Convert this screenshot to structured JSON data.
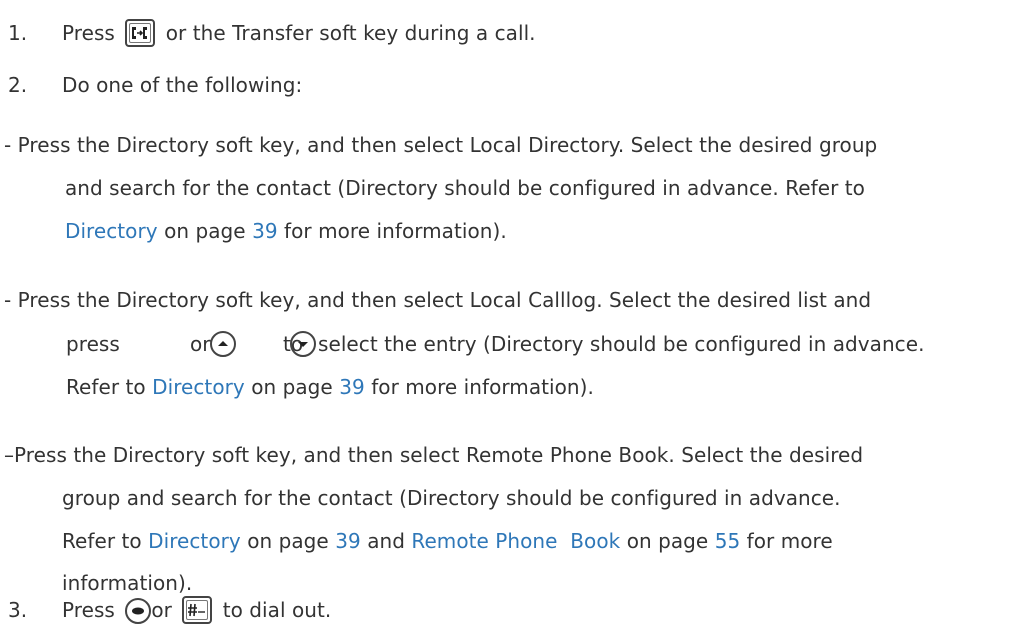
{
  "steps": {
    "s1": {
      "num": "1.",
      "press": "Press",
      "rest": "or the Transfer soft key during a call."
    },
    "s2": {
      "num": "2.",
      "text": "Do one of the following:"
    },
    "s3": {
      "num": "3.",
      "press": "Press",
      "or": "or",
      "rest": "to dial out."
    }
  },
  "bullets": {
    "b1": {
      "l1": "- Press the Directory soft key, and then select Local Directory. Select the desired group",
      "l2": "and search for the contact (Directory should be configured in advance. Refer to",
      "link": "Directory",
      "on_page": "on page",
      "page": "39",
      "tail": "for more information)."
    },
    "b2": {
      "l1": "- Press the Directory soft key, and then select Local Calllog. Select the desired list and",
      "press": "press",
      "or": "or",
      "to": "to",
      "select_rest": "select the entry (Directory should be configured in advance.",
      "refer": "Refer to",
      "link": "Directory",
      "on_page": "on page",
      "page": "39",
      "tail": "for more information)."
    },
    "b3": {
      "l1": "–Press the Directory soft key, and then select Remote Phone Book. Select the desired",
      "l2": "group and search for the contact (Directory should be configured in advance.",
      "refer": "Refer to",
      "link1": "Directory",
      "on_page1": "on page",
      "page1": "39",
      "and": "and",
      "link2": "Remote Phone  Book",
      "on_page2": "on page",
      "page2": "55",
      "more": "for more",
      "l4": "information)."
    }
  },
  "icons": {
    "transfer": "transfer-key-icon",
    "up": "up-arrow-key-icon",
    "down": "down-arrow-key-icon",
    "ok": "ok-key-icon",
    "send": "send-key-icon"
  },
  "colors": {
    "text": "#333333",
    "link": "#2e77b8"
  }
}
